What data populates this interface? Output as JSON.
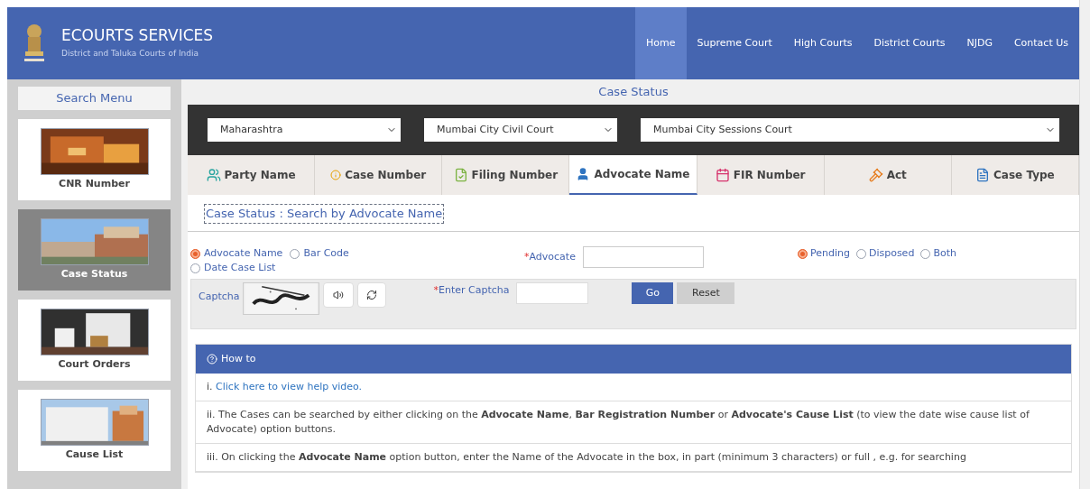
{
  "header": {
    "title": "ECOURTS SERVICES",
    "subtitle": "District and Taluka Courts of India",
    "nav": [
      {
        "label": "Home",
        "selected": true
      },
      {
        "label": "Supreme Court",
        "selected": false
      },
      {
        "label": "High Courts",
        "selected": false
      },
      {
        "label": "District Courts",
        "selected": false
      },
      {
        "label": "NJDG",
        "selected": false
      },
      {
        "label": "Contact Us",
        "selected": false
      }
    ]
  },
  "sidebar": {
    "title": "Search Menu",
    "items": [
      {
        "label": "CNR Number",
        "selected": false
      },
      {
        "label": "Case Status",
        "selected": true
      },
      {
        "label": "Court Orders",
        "selected": false
      },
      {
        "label": "Cause List",
        "selected": false
      }
    ]
  },
  "page_title": "Case Status",
  "selects": [
    "Maharashtra",
    "Mumbai City Civil Court",
    "Mumbai City Sessions Court"
  ],
  "tabs": [
    {
      "label": "Party Name",
      "kind": "party",
      "selected": false
    },
    {
      "label": "Case Number",
      "kind": "case",
      "selected": false
    },
    {
      "label": "Filing Number",
      "kind": "filing",
      "selected": false
    },
    {
      "label": "Advocate Name",
      "kind": "advocate",
      "selected": true
    },
    {
      "label": "FIR Number",
      "kind": "fir",
      "selected": false
    },
    {
      "label": "Act",
      "kind": "act",
      "selected": false
    },
    {
      "label": "Case Type",
      "kind": "type",
      "selected": false
    }
  ],
  "form": {
    "heading": "Case Status : Search by Advocate Name",
    "search_by": [
      {
        "label": "Advocate Name",
        "selected": true
      },
      {
        "label": "Bar Code",
        "selected": false
      },
      {
        "label": "Date Case List",
        "selected": false
      }
    ],
    "advocate_label": "*Advocate",
    "status": [
      {
        "label": "Pending",
        "selected": true
      },
      {
        "label": "Disposed",
        "selected": false
      },
      {
        "label": "Both",
        "selected": false
      }
    ],
    "captcha_label": "Captcha",
    "enter_captcha_label": "*Enter Captcha",
    "go": "Go",
    "reset": "Reset"
  },
  "howto": {
    "title": "How to",
    "lines": [
      {
        "kind": "link",
        "text": "Click here to view help video.",
        "prefix": "i. "
      },
      {
        "kind": "text",
        "text": "ii. The Cases can be searched by either clicking on the **Advocate Name**, **Bar Registration Number** or **Advocate's Cause List** (to view the date wise cause list of Advocate) option buttons."
      },
      {
        "kind": "text",
        "text": "iii. On clicking the **Advocate Name** option button, enter the Name of the Advocate in the box, in part (minimum 3 characters) or full , e.g. for searching"
      }
    ]
  }
}
